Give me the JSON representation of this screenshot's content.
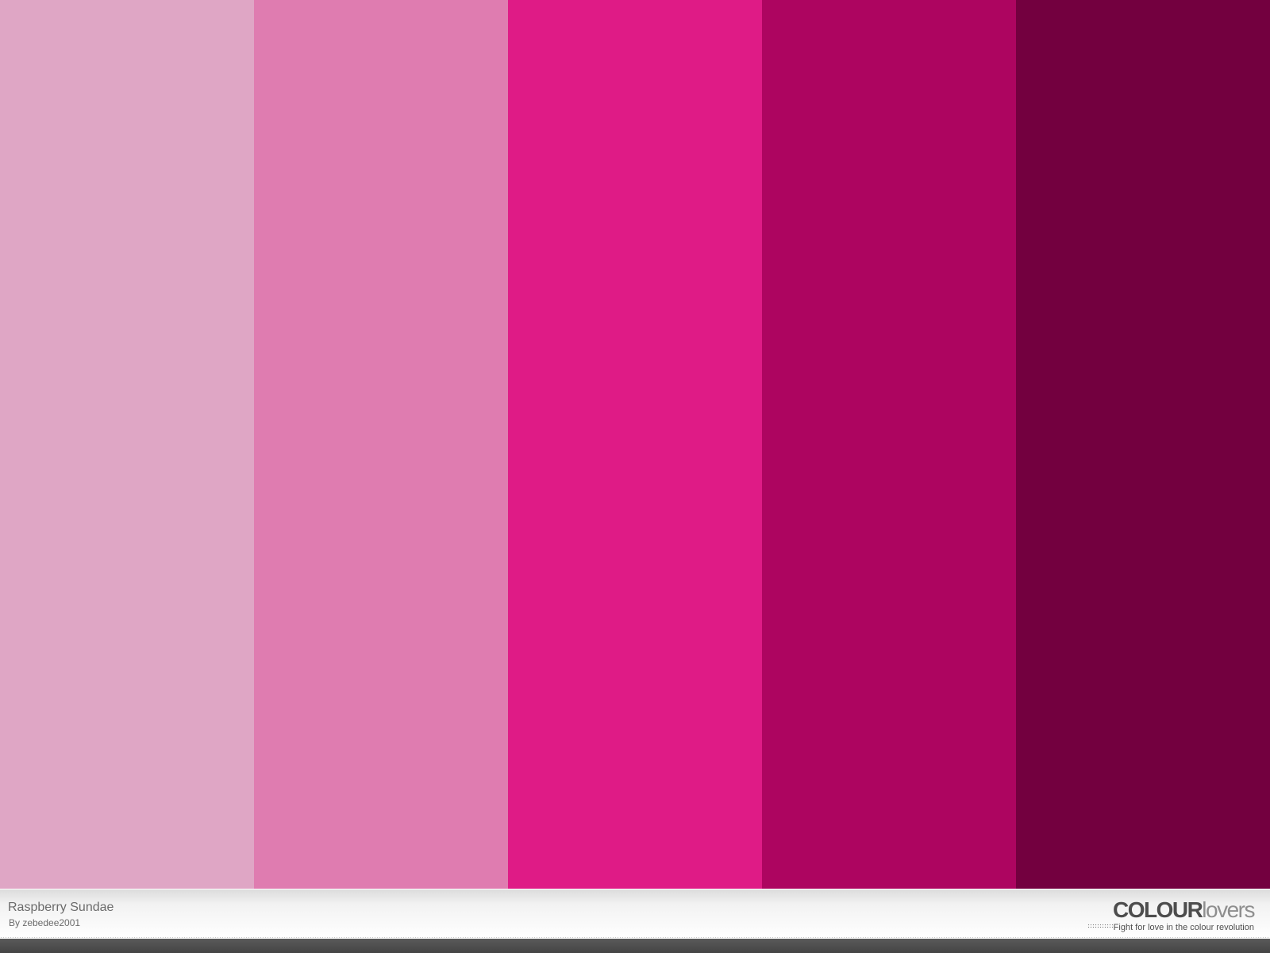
{
  "palette": {
    "title": "Raspberry Sundae",
    "author_line": "By zebedee2001",
    "colors": [
      "#DFA6C5",
      "#DF7CB0",
      "#DF1B86",
      "#AD0560",
      "#73003F"
    ]
  },
  "branding": {
    "logo_bold": "COLOUR",
    "logo_light": "lovers",
    "tagline": "Fight for love in the colour revolution"
  }
}
